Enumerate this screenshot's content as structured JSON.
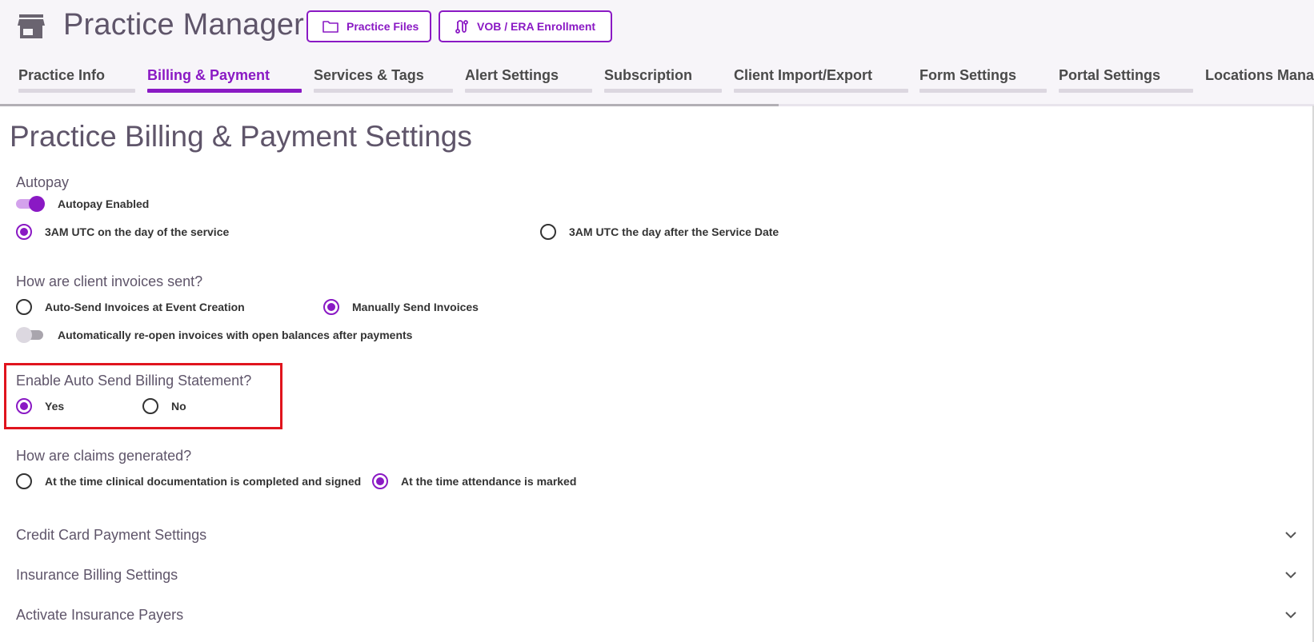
{
  "header": {
    "title": "Practice Manager",
    "store_icon": "store-icon",
    "buttons": [
      {
        "label": "Practice Files",
        "icon": "folder-icon"
      },
      {
        "label": "VOB / ERA Enrollment",
        "icon": "route-icon"
      }
    ]
  },
  "tabs": [
    {
      "label": "Practice Info",
      "active": false
    },
    {
      "label": "Billing & Payment",
      "active": true
    },
    {
      "label": "Services & Tags",
      "active": false
    },
    {
      "label": "Alert Settings",
      "active": false
    },
    {
      "label": "Subscription",
      "active": false
    },
    {
      "label": "Client Import/Export",
      "active": false
    },
    {
      "label": "Form Settings",
      "active": false
    },
    {
      "label": "Portal Settings",
      "active": false
    },
    {
      "label": "Locations Manag",
      "active": false
    }
  ],
  "page": {
    "title": "Practice Billing & Payment Settings"
  },
  "autopay": {
    "section_label": "Autopay",
    "toggle_label": "Autopay Enabled",
    "toggle_on": true,
    "options": [
      {
        "label": "3AM UTC on the day of the service",
        "selected": true
      },
      {
        "label": "3AM UTC the day after the Service Date",
        "selected": false
      }
    ]
  },
  "invoices": {
    "section_label": "How are client invoices sent?",
    "options": [
      {
        "label": "Auto-Send Invoices at Event Creation",
        "selected": false
      },
      {
        "label": "Manually Send Invoices",
        "selected": true
      }
    ],
    "reopen_toggle_label": "Automatically re-open invoices with open balances after payments",
    "reopen_toggle_on": false
  },
  "billing_statement": {
    "section_label": "Enable Auto Send Billing Statement?",
    "options": [
      {
        "label": "Yes",
        "selected": true
      },
      {
        "label": "No",
        "selected": false
      }
    ],
    "highlight_color": "#e0141d"
  },
  "claims": {
    "section_label": "How are claims generated?",
    "options": [
      {
        "label": "At the time clinical documentation is completed and signed",
        "selected": false
      },
      {
        "label": "At the time attendance is marked",
        "selected": true
      }
    ]
  },
  "accordions": [
    {
      "label": "Credit Card Payment Settings",
      "icon": "chevron-down-icon"
    },
    {
      "label": "Insurance Billing Settings",
      "icon": "chevron-down-icon"
    },
    {
      "label": "Activate Insurance Payers",
      "icon": "chevron-down-icon"
    }
  ],
  "colors": {
    "accent": "#8a19c4",
    "heading": "#5f556a",
    "header_bg": "#f7f5f9"
  }
}
